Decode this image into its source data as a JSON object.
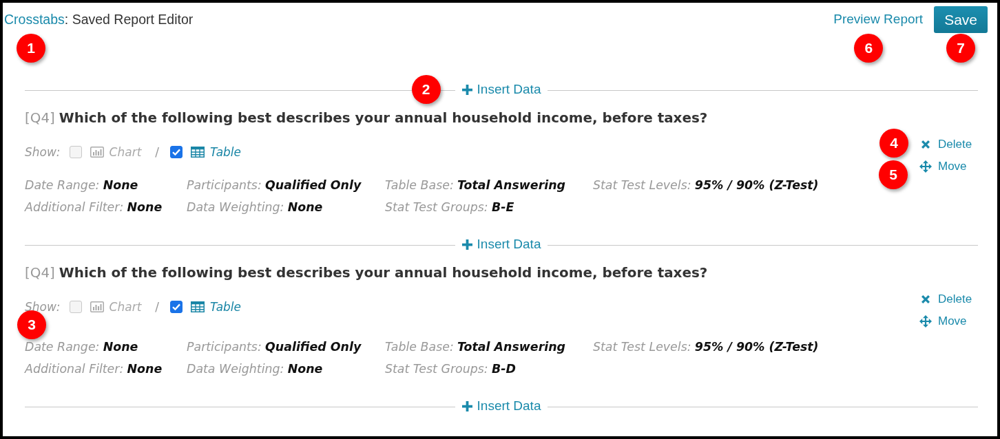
{
  "header": {
    "link": "Crosstabs",
    "separator": ":",
    "title": "Saved Report Editor",
    "callout": "1"
  },
  "actions": [
    {
      "kind": "link",
      "label": "Preview Report",
      "callout": "6"
    },
    {
      "kind": "button",
      "label": "Save",
      "callout": "7"
    }
  ],
  "sections": [
    {
      "kind": "insert",
      "label": "Insert Data",
      "callout": "2"
    },
    {
      "kind": "question",
      "code": "[Q4]",
      "text": "Which of the following best describes your annual household income, before taxes?",
      "show_label": "Show:",
      "separator": "/",
      "options": [
        {
          "kind": "chart",
          "label": "Chart",
          "checked": false
        },
        {
          "kind": "table",
          "label": "Table",
          "checked": true
        }
      ],
      "detail_rows": [
        [
          {
            "label": "Date Range:",
            "value": "None"
          },
          {
            "label": "Participants:",
            "value": "Qualified Only"
          },
          {
            "label": "Table Base:",
            "value": "Total Answering"
          },
          {
            "label": "Stat Test Levels:",
            "value": "95% / 90% (Z-Test)"
          }
        ],
        [
          {
            "label": "Additional Filter:",
            "value": "None"
          },
          {
            "label": "Data Weighting:",
            "value": "None"
          },
          {
            "label": "Stat Test Groups:",
            "value": "B-E"
          }
        ]
      ],
      "tools": [
        {
          "kind": "delete",
          "label": "Delete",
          "callout": "4"
        },
        {
          "kind": "move",
          "label": "Move",
          "callout": "5"
        }
      ]
    },
    {
      "kind": "insert",
      "label": "Insert Data"
    },
    {
      "kind": "question",
      "code": "[Q4]",
      "text": "Which of the following best describes your annual household income, before taxes?",
      "show_label": "Show:",
      "separator": "/",
      "options": [
        {
          "kind": "chart",
          "label": "Chart",
          "checked": false
        },
        {
          "kind": "table",
          "label": "Table",
          "checked": true
        }
      ],
      "detail_rows": [
        [
          {
            "label": "Date Range:",
            "value": "None"
          },
          {
            "label": "Participants:",
            "value": "Qualified Only"
          },
          {
            "label": "Table Base:",
            "value": "Total Answering"
          },
          {
            "label": "Stat Test Levels:",
            "value": "95% / 90% (Z-Test)"
          }
        ],
        [
          {
            "label": "Additional Filter:",
            "value": "None"
          },
          {
            "label": "Data Weighting:",
            "value": "None"
          },
          {
            "label": "Stat Test Groups:",
            "value": "B-D"
          }
        ]
      ],
      "details_callout": "3",
      "tools": [
        {
          "kind": "delete",
          "label": "Delete"
        },
        {
          "kind": "move",
          "label": "Move"
        }
      ]
    },
    {
      "kind": "insert",
      "label": "Insert Data"
    }
  ]
}
